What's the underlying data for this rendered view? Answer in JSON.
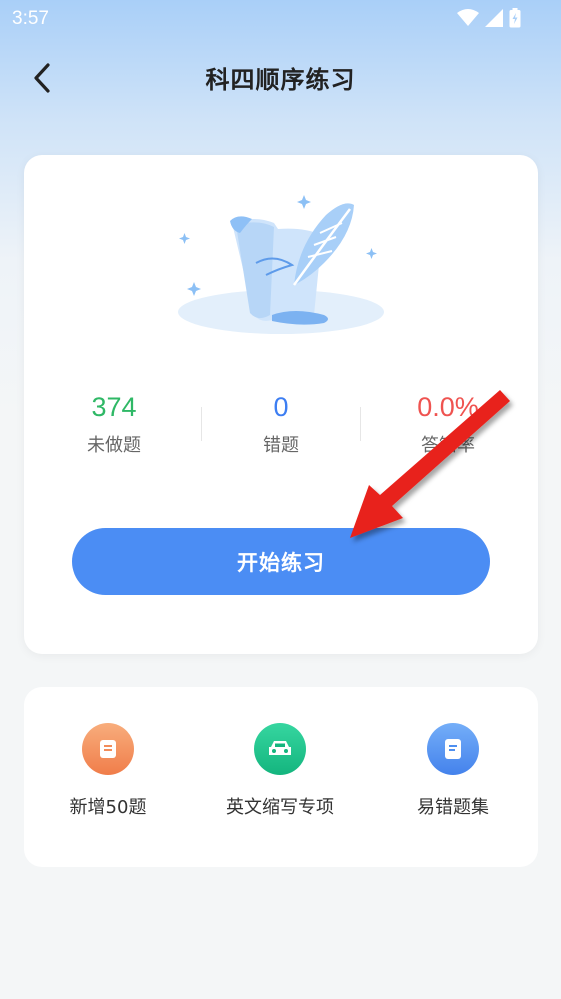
{
  "status_bar": {
    "time": "3:57"
  },
  "header": {
    "title": "科四顺序练习"
  },
  "stats": [
    {
      "value": "374",
      "label": "未做题",
      "color": "#2fb866"
    },
    {
      "value": "0",
      "label": "错题",
      "color": "#3d7ef2"
    },
    {
      "value": "0.0%",
      "label": "答错率",
      "color": "#ef5350"
    }
  ],
  "start_button": {
    "label": "开始练习"
  },
  "tools": [
    {
      "label": "新增50题",
      "icon": "scroll-icon",
      "color": "#f28c5a"
    },
    {
      "label": "英文缩写专项",
      "icon": "car-icon",
      "color": "#21c18a"
    },
    {
      "label": "易错题集",
      "icon": "document-icon",
      "color": "#4e8ff0"
    }
  ],
  "annotation": {
    "type": "arrow",
    "color": "#e8231c"
  }
}
